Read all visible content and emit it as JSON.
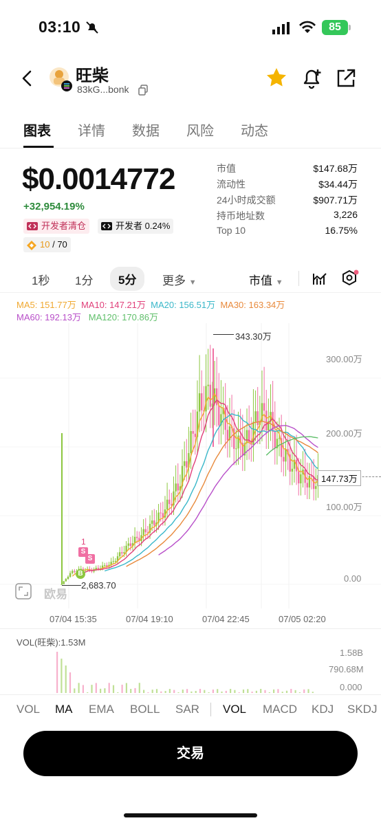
{
  "status_bar": {
    "time": "03:10",
    "battery": "85"
  },
  "header": {
    "title": "旺柴",
    "address": "83kG...bonk"
  },
  "tabs": [
    "图表",
    "详情",
    "数据",
    "风险",
    "动态"
  ],
  "price": {
    "value": "$0.0014772",
    "change": "+32,954.19%"
  },
  "tags": {
    "dev_cleared": "开发者清仓",
    "dev_share": "开发者 0.24%",
    "score": "10",
    "score_total": "/ 70"
  },
  "stats": [
    {
      "label": "市值",
      "value": "$147.68万"
    },
    {
      "label": "流动性",
      "value": "$34.44万"
    },
    {
      "label": "24小时成交额",
      "value": "$907.71万"
    },
    {
      "label": "持币地址数",
      "value": "3,226"
    },
    {
      "label": "Top 10",
      "value": "16.75%"
    }
  ],
  "intervals": {
    "s1": "1秒",
    "m1": "1分",
    "m5": "5分",
    "more": "更多",
    "metric": "市值"
  },
  "ma_legend": {
    "ma5": "MA5: 151.77万",
    "ma10": "MA10: 147.21万",
    "ma20": "MA20: 156.51万",
    "ma30": "MA30: 163.34万",
    "ma60": "MA60: 192.13万",
    "ma120": "MA120: 170.86万"
  },
  "chart_data": {
    "type": "candlestick",
    "y_ticks": [
      "300.00万",
      "200.00万",
      "100.00万",
      "0.00"
    ],
    "x_ticks": [
      "07/04 15:35",
      "07/04 19:10",
      "07/04 22:45",
      "07/05 02:20"
    ],
    "high_label": "343.30万",
    "low_label": "2,683.70",
    "current_label": "147.73万",
    "marker_labels": {
      "sell": "S",
      "buy": "B",
      "count": "1"
    },
    "approx_close_values_wan": [
      0.3,
      18,
      22,
      20,
      25,
      30,
      45,
      60,
      70,
      85,
      100,
      120,
      150,
      200,
      260,
      280,
      250,
      220,
      200,
      210,
      250,
      240,
      200,
      180,
      160,
      150,
      147.7
    ],
    "ylim": [
      0,
      360
    ]
  },
  "watermark": "欧易",
  "volume": {
    "label": "VOL(旺柴):1.53M",
    "y_ticks": [
      "1.58B",
      "790.68M",
      "0.000"
    ]
  },
  "indicators_main": [
    "VOL",
    "MA",
    "EMA",
    "BOLL",
    "SAR"
  ],
  "indicators_sub": [
    "VOL",
    "MACD",
    "KDJ",
    "SKDJ"
  ],
  "trade_button": "交易",
  "colors": {
    "up": "#8cc63f",
    "down": "#f06fa3",
    "ma5": "#f0a830",
    "ma10": "#e0407a",
    "ma20": "#39b7c9",
    "ma30": "#e8893b",
    "ma60": "#b84fc9",
    "ma120": "#5fbf6a",
    "star": "#f5b400",
    "battery": "#34c759"
  }
}
